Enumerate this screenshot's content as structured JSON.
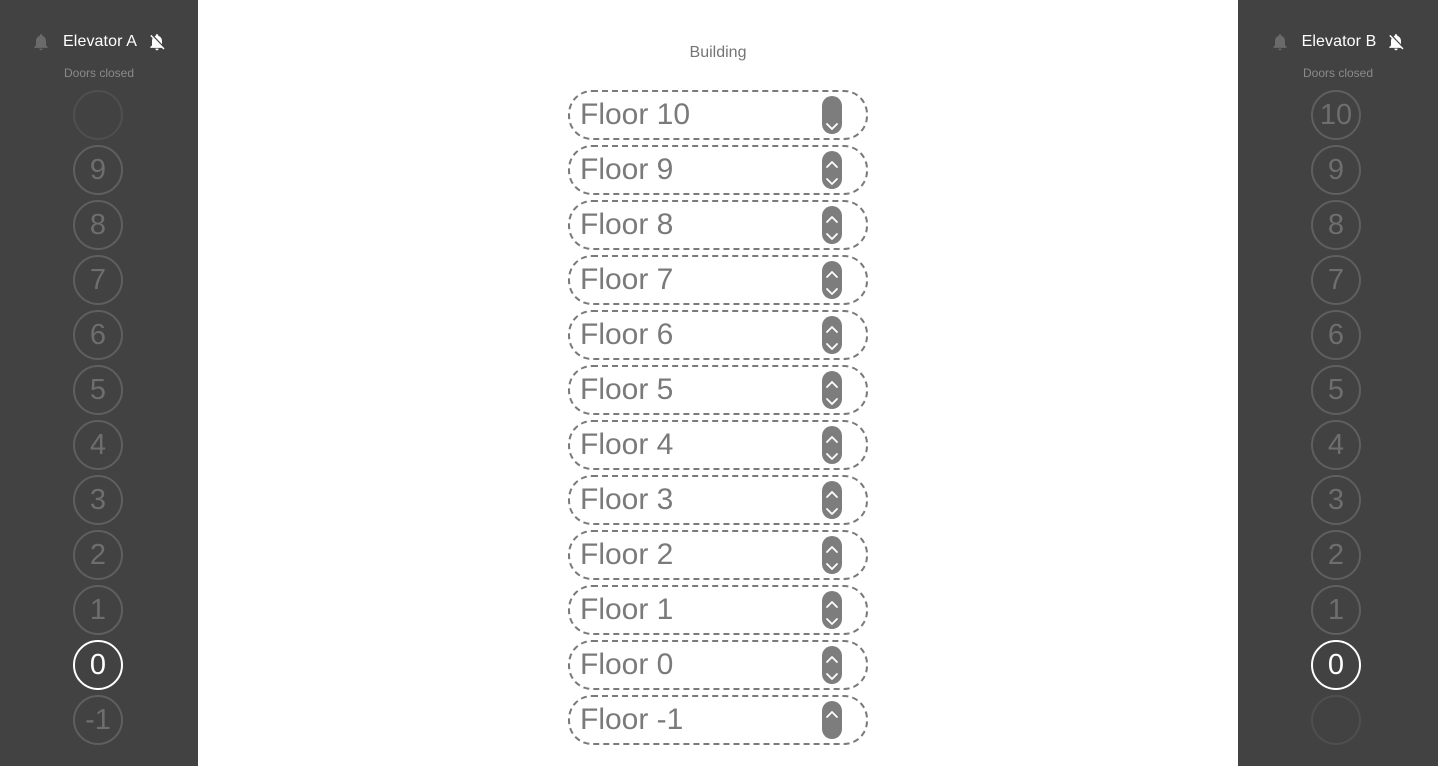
{
  "building": {
    "title": "Building"
  },
  "elevators": [
    {
      "name": "Elevator A",
      "status": "Doors closed",
      "current_floor": "0",
      "buttons": [
        "",
        "9",
        "8",
        "7",
        "6",
        "5",
        "4",
        "3",
        "2",
        "1",
        "0",
        "-1"
      ]
    },
    {
      "name": "Elevator B",
      "status": "Doors closed",
      "current_floor": "0",
      "buttons": [
        "10",
        "9",
        "8",
        "7",
        "6",
        "5",
        "4",
        "3",
        "2",
        "1",
        "0",
        ""
      ]
    }
  ],
  "floors": [
    {
      "label": "Floor 10",
      "up": false,
      "down": true
    },
    {
      "label": "Floor 9",
      "up": true,
      "down": true
    },
    {
      "label": "Floor 8",
      "up": true,
      "down": true
    },
    {
      "label": "Floor 7",
      "up": true,
      "down": true
    },
    {
      "label": "Floor 6",
      "up": true,
      "down": true
    },
    {
      "label": "Floor 5",
      "up": true,
      "down": true
    },
    {
      "label": "Floor 4",
      "up": true,
      "down": true
    },
    {
      "label": "Floor 3",
      "up": true,
      "down": true
    },
    {
      "label": "Floor 2",
      "up": true,
      "down": true
    },
    {
      "label": "Floor 1",
      "up": true,
      "down": true
    },
    {
      "label": "Floor 0",
      "up": true,
      "down": true
    },
    {
      "label": "Floor -1",
      "up": true,
      "down": false
    }
  ],
  "icons": {
    "bell": "bell-icon",
    "bell_off": "bell-off-icon",
    "up": "chevron-up-icon",
    "down": "chevron-down-icon"
  },
  "colors": {
    "panel": "#424242",
    "accent": "#ffffff",
    "muted": "#7a7a7a"
  }
}
